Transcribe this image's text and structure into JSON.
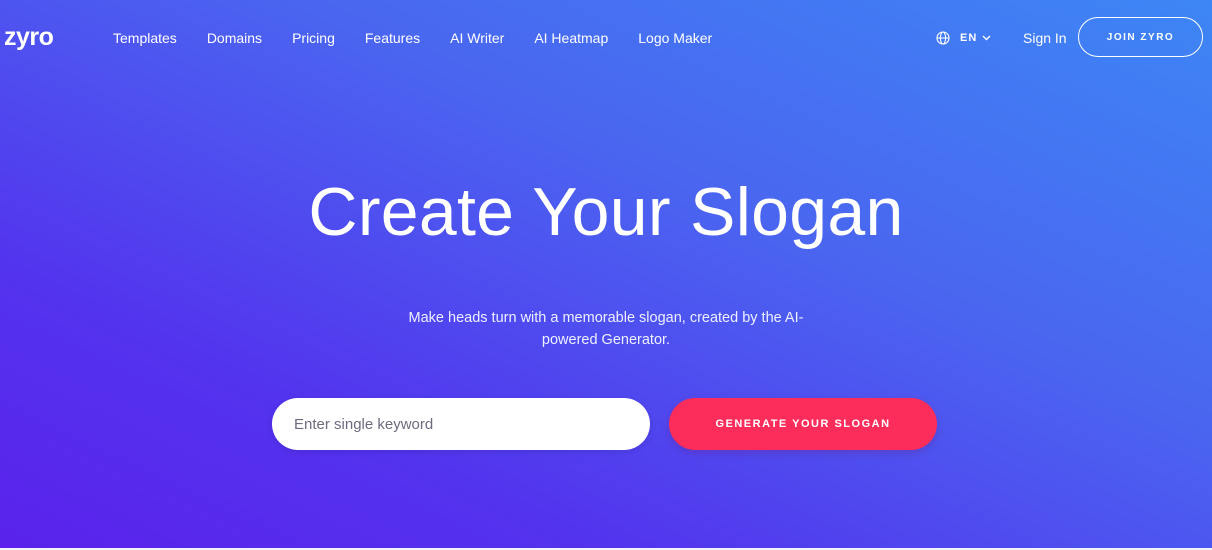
{
  "brand": {
    "logo_text": "zyro"
  },
  "nav": {
    "links": [
      "Templates",
      "Domains",
      "Pricing",
      "Features",
      "AI Writer",
      "AI Heatmap",
      "Logo Maker"
    ],
    "language_code": "EN",
    "sign_in": "Sign In",
    "join_label": "JOIN ZYRO"
  },
  "hero": {
    "title": "Create Your Slogan",
    "subtitle": "Make heads turn with a memorable slogan, created by the AI-powered Generator.",
    "input_placeholder": "Enter single keyword",
    "input_value": "",
    "button_label": "GENERATE YOUR SLOGAN"
  },
  "colors": {
    "gradient_light": "#3d86f5",
    "gradient_dark": "#5a22ec",
    "cta": "#fc2d5b",
    "text": "#ffffff"
  },
  "icons": {
    "language": "globe-icon",
    "dropdown": "chevron-down-icon"
  }
}
